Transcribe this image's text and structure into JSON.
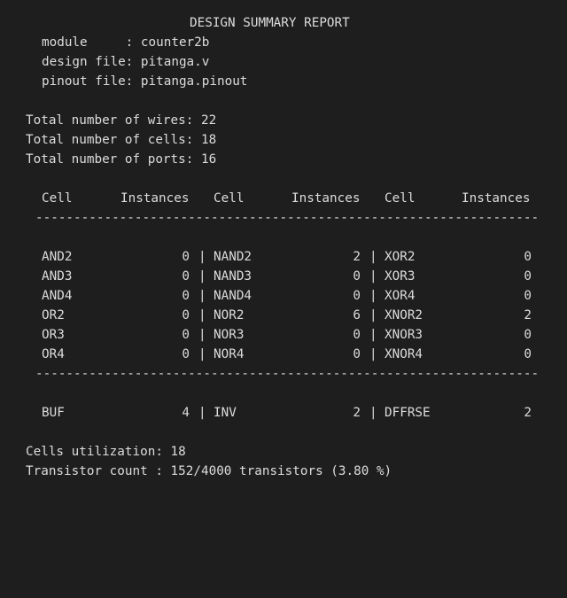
{
  "report": {
    "title": "DESIGN SUMMARY REPORT",
    "module_label": "module     : ",
    "module_value": "counter2b",
    "design_file_label": "design file: ",
    "design_file_value": "pitanga.v",
    "pinout_file_label": "pinout file: ",
    "pinout_file_value": "pitanga.pinout",
    "wires_label": "Total number of wires: ",
    "wires_value": "22",
    "cells_label": "Total number of cells: ",
    "cells_value": "18",
    "ports_label": "Total number of ports: ",
    "ports_value": "16",
    "table_headers": [
      "Cell",
      "Instances",
      "Cell",
      "Instances",
      "Cell",
      "Instances"
    ],
    "rows": [
      [
        "AND2",
        "0",
        "NAND2",
        "2",
        "XOR2",
        "0"
      ],
      [
        "AND3",
        "0",
        "NAND3",
        "0",
        "XOR3",
        "0"
      ],
      [
        "AND4",
        "0",
        "NAND4",
        "0",
        "XOR4",
        "0"
      ],
      [
        "OR2",
        "0",
        "NOR2",
        "6",
        "XNOR2",
        "2"
      ],
      [
        "OR3",
        "0",
        "NOR3",
        "0",
        "XNOR3",
        "0"
      ],
      [
        "OR4",
        "0",
        "NOR4",
        "0",
        "XNOR4",
        "0"
      ]
    ],
    "bottom_row": [
      "BUF",
      "4",
      "INV",
      "2",
      "DFFRSE",
      "2"
    ],
    "separator": "|",
    "dash_line": "--------------------------------------------------------------------------------",
    "utilization_label": "Cells utilization: ",
    "utilization_value": "18",
    "transistor_label": "Transistor count : ",
    "transistor_value": "152/4000 transistors (3.80 %)"
  }
}
